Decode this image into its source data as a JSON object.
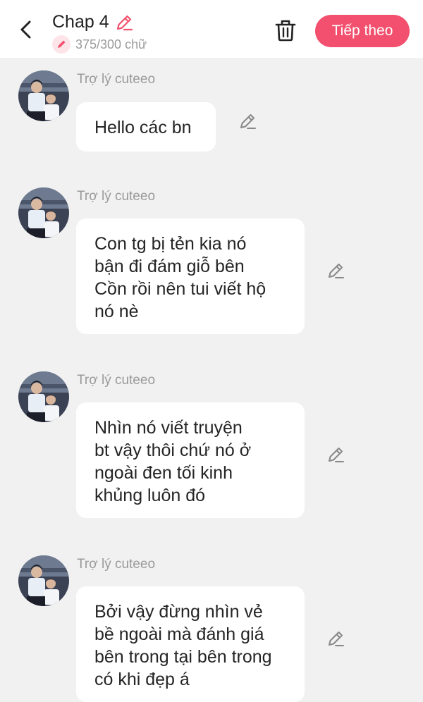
{
  "header": {
    "title": "Chap 4",
    "word_counter": "375/300 chữ",
    "next_label": "Tiếp theo",
    "accent_color": "#f2506e"
  },
  "messages": [
    {
      "sender": "Trợ lý cuteeo",
      "text": "Hello các bn"
    },
    {
      "sender": "Trợ lý cuteeo",
      "text": "Con tg bị tẻn kia nó\nbận đi đám giỗ bên\nCồn rồi nên tui viết hộ\nnó nè"
    },
    {
      "sender": "Trợ lý cuteeo",
      "text": "Nhìn nó viết truyện\nbt vậy thôi chứ nó ở\nngoài đen tối kinh\nkhủng luôn đó"
    },
    {
      "sender": "Trợ lý cuteeo",
      "text": "Bởi vậy đừng nhìn vẻ\nbề ngoài mà đánh giá\nbên trong tại bên trong\ncó khi đẹp á"
    }
  ]
}
